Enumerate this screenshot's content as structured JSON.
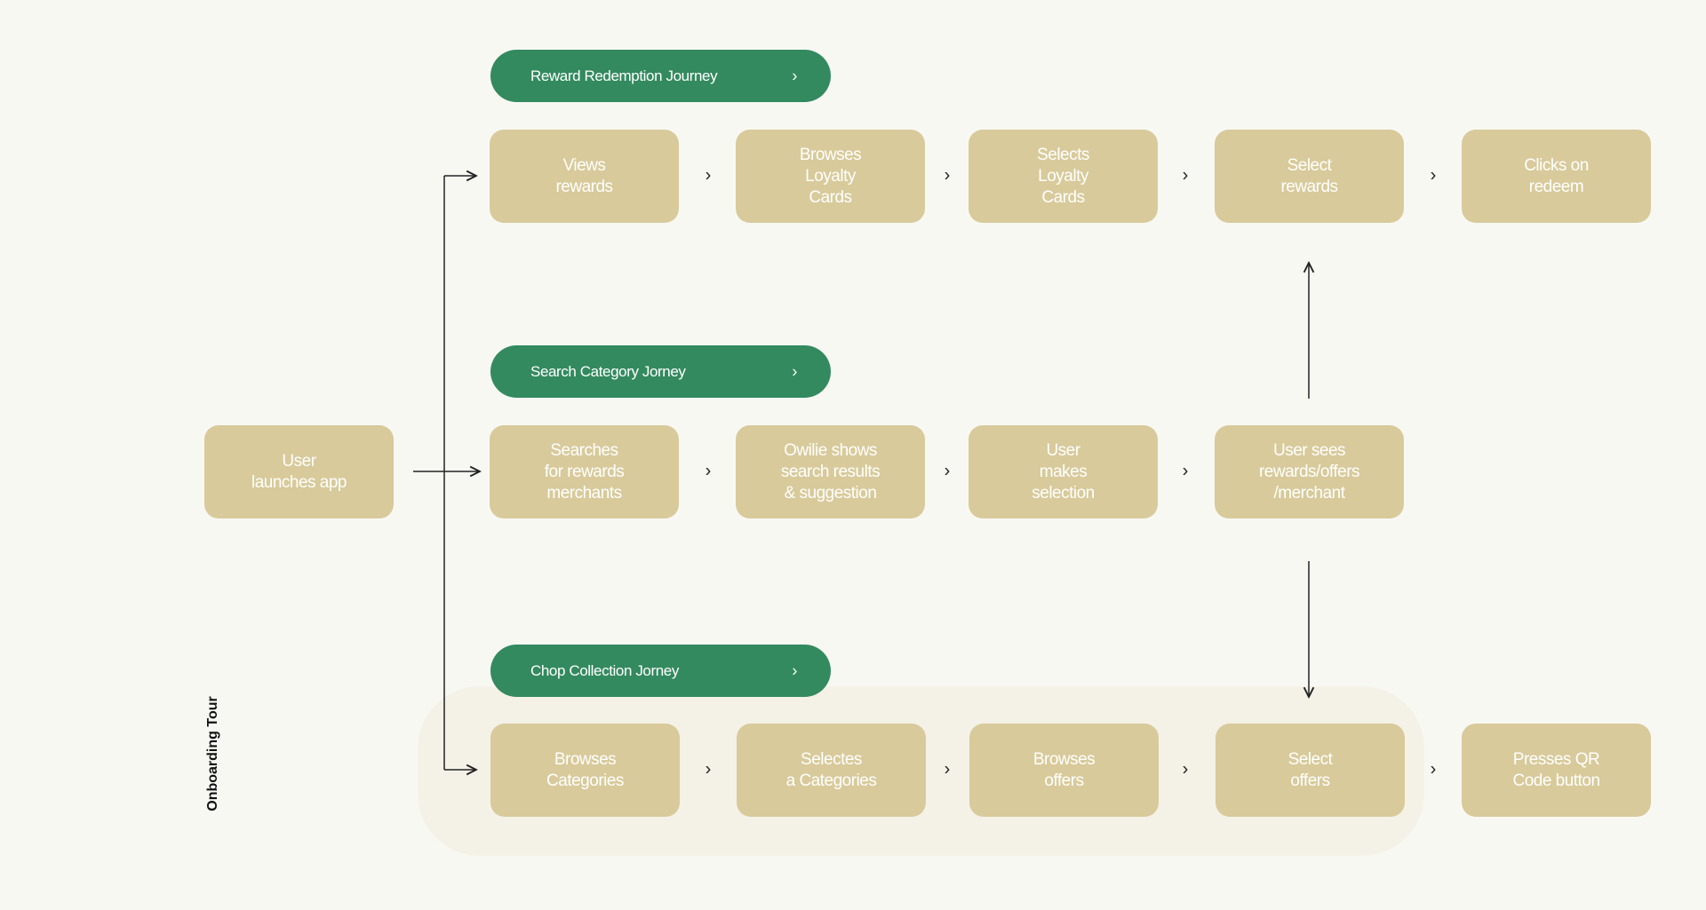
{
  "colors": {
    "background": "#f8f8f3",
    "journey_pill": "#338a5f",
    "step_box": "#d8ca9a",
    "onboarding_region": "#f4f1e7"
  },
  "start": {
    "label": "User\nlaunches app"
  },
  "side_label": "Onboarding Tour",
  "journeys": [
    {
      "title": "Reward Redemption Journey",
      "icon": "chevron-right-icon",
      "steps": [
        "Views\nrewards",
        "Browses\nLoyalty\nCards",
        "Selects\nLoyalty\nCards",
        "Select\nrewards",
        "Clicks on\nredeem"
      ]
    },
    {
      "title": "Search Category Jorney",
      "icon": "chevron-right-icon",
      "steps": [
        "Searches\nfor rewards\nmerchants",
        "Owilie shows\nsearch results\n& suggestion",
        "User\nmakes\nselection",
        "User sees\nrewards/offers\n/merchant"
      ]
    },
    {
      "title": "Chop Collection Jorney",
      "icon": "chevron-right-icon",
      "steps": [
        "Browses\nCategories",
        "Selectes\na Categories",
        "Browses\noffers",
        "Select\noffers",
        "Presses QR\nCode button"
      ]
    }
  ],
  "separator": "›"
}
